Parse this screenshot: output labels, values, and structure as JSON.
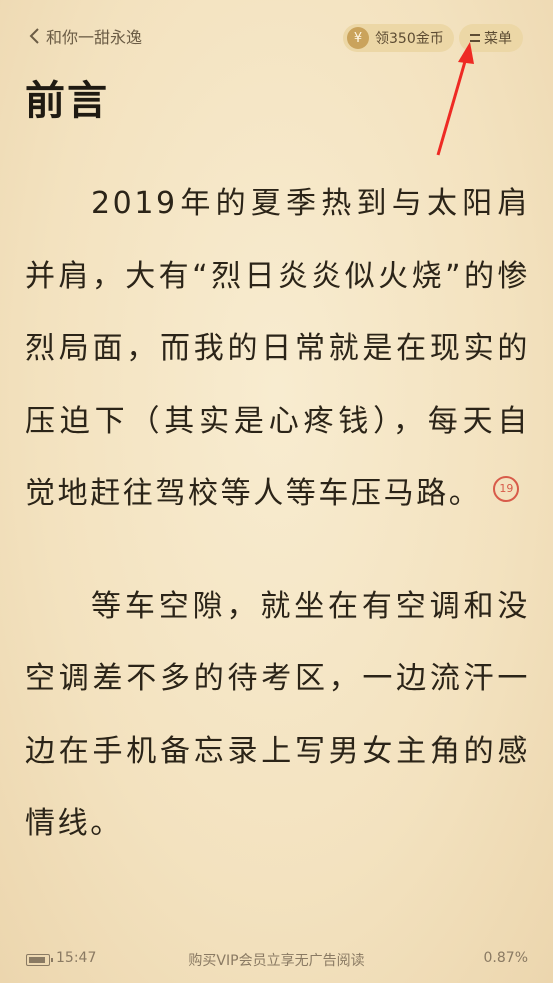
{
  "header": {
    "back_label": "和你一甜永逸",
    "coin_symbol": "¥",
    "coin_label": "领350金币",
    "menu_label": "菜单"
  },
  "chapter": {
    "title": "前言",
    "paragraphs": [
      "2019年的夏季热到与太阳肩并肩，大有“烈日炎炎似火烧”的惨烈局面，而我的日常就是在现实的压迫下（其实是心疼钱），每天自觉地赶往驾校等人等车压马路。",
      "等车空隙，就坐在有空调和没空调差不多的待考区，一边流汗一边在手机备忘录上写男女主角的感情线。"
    ],
    "note_count": "19"
  },
  "footer": {
    "time": "15:47",
    "ad_text": "购买VIP会员立享无广告阅读",
    "progress": "0.87%"
  },
  "colors": {
    "accent": "#d85b4a",
    "pill_bg": "#ecd7a6",
    "annotation_arrow": "#ee2a24"
  }
}
